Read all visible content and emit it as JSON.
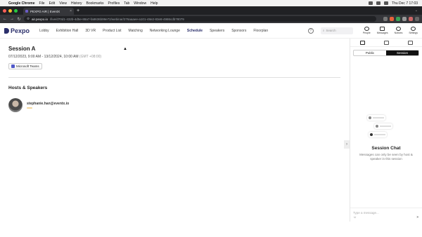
{
  "menubar": {
    "app_name": "Google Chrome",
    "items": [
      "File",
      "Edit",
      "View",
      "History",
      "Bookmarks",
      "Profiles",
      "Tab",
      "Window",
      "Help"
    ],
    "clock": "Thu Dec 7 17:03"
  },
  "browser": {
    "tab_title": "PEXPO AIR | EventX",
    "url_host": "air.pexpo.io",
    "url_path": "/live/d70d1-432b-4d5e-88a7-fa8636b99e72/webinar/276aaaee-a101-48e2-83e8-4986cdb78079"
  },
  "nav": {
    "brand": "Pexpo",
    "menu": [
      "Lobby",
      "Exhibition Hall",
      "3D VR",
      "Product List",
      "Matching",
      "Networking Lounge",
      "Schedule",
      "Speakers",
      "Sponsors",
      "Floorplan"
    ],
    "search_placeholder": "Search",
    "icons": [
      {
        "label": "People",
        "icon": "people-icon"
      },
      {
        "label": "Messages",
        "icon": "messages-icon"
      },
      {
        "label": "Notices",
        "icon": "bell-icon"
      },
      {
        "label": "Settings",
        "icon": "gear-icon"
      }
    ]
  },
  "session": {
    "title": "Session A",
    "datetime": "07/12/2023, 9:00 AM - 13/12/2024, 10:00 AM",
    "timezone": "(GMT +08:00)",
    "platform": "Microsoft Teams",
    "hosts_heading": "Hosts & Speakers",
    "speaker_email": "stephanie.han@eventx.io"
  },
  "panel": {
    "toggle": [
      "Public",
      "Session"
    ],
    "chat_title": "Session Chat",
    "chat_desc": "Messages can only be seen by host & speaker in this session",
    "input_placeholder": "Type a message..."
  }
}
